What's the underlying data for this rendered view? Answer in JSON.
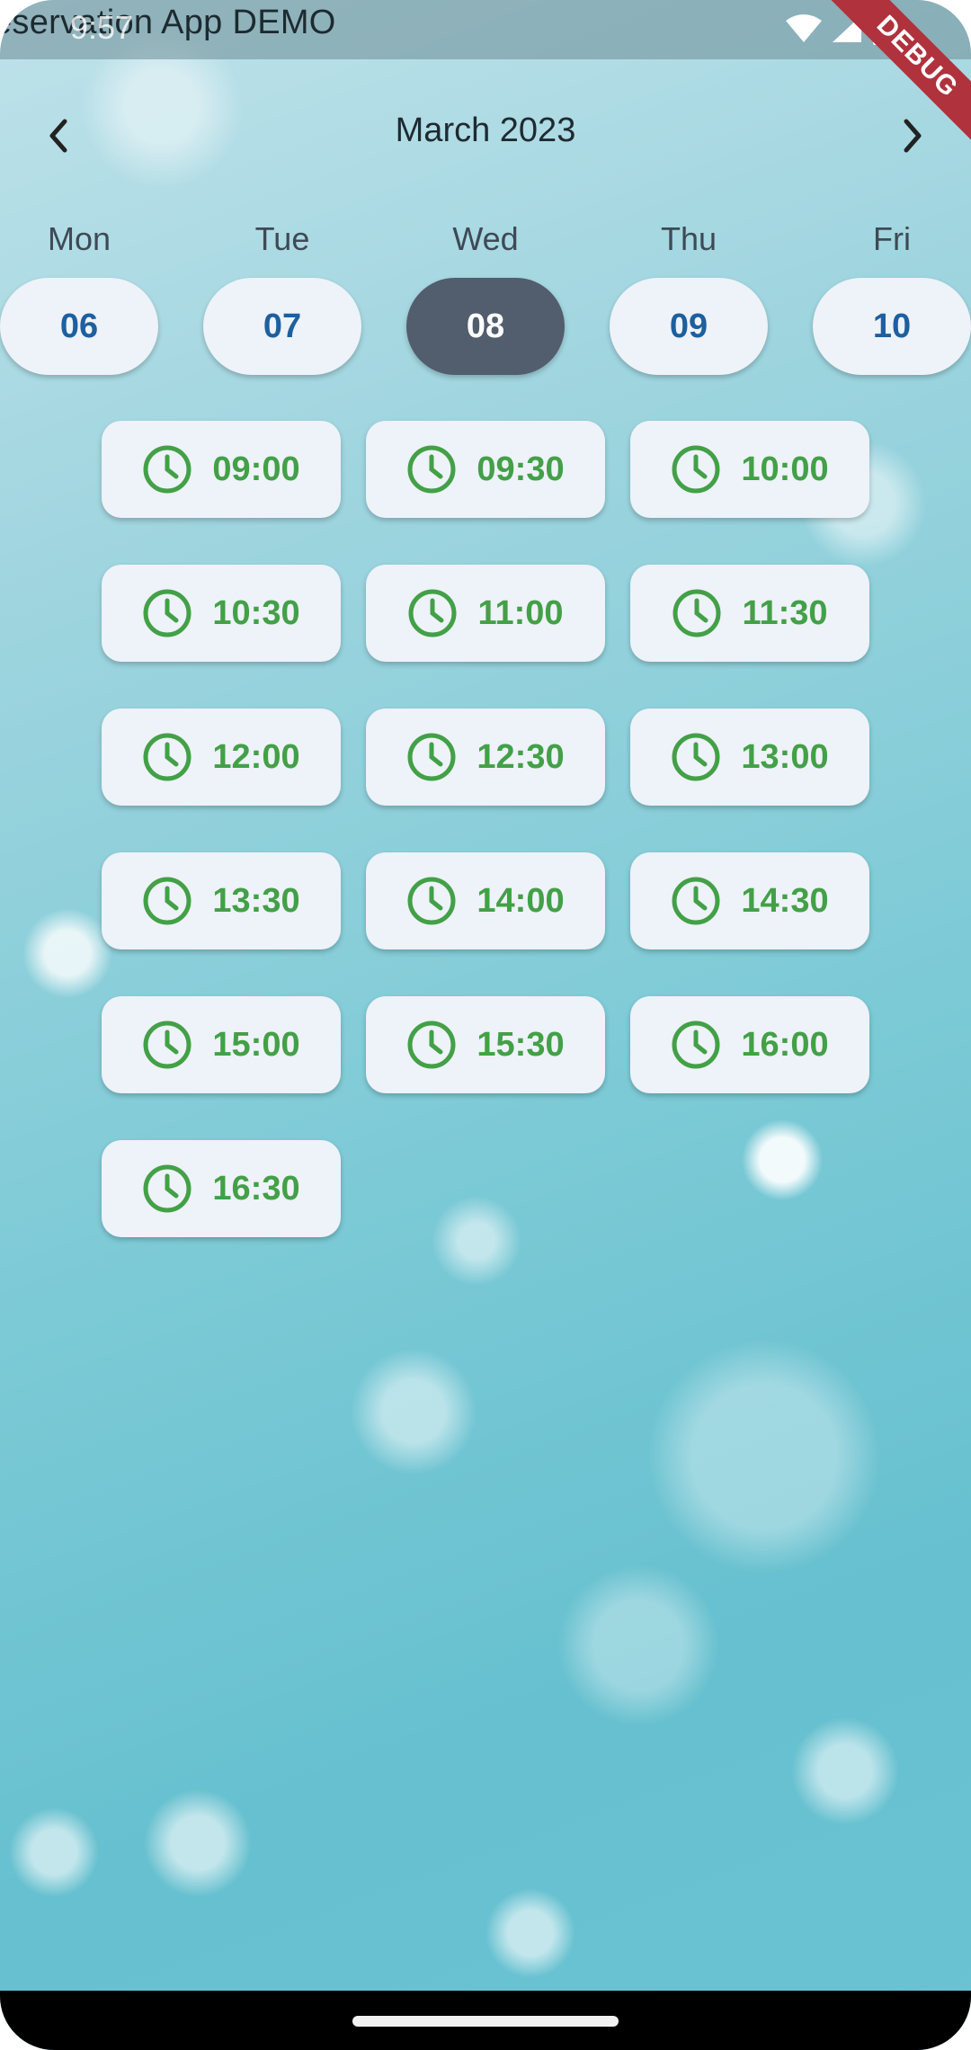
{
  "status_bar": {
    "app_title": "eservation App DEMO",
    "time": "9:57",
    "debug_label": "DEBUG"
  },
  "header": {
    "month_title": "March 2023",
    "prev_icon": "chevron-left-icon",
    "next_icon": "chevron-right-icon"
  },
  "days": [
    {
      "name": "Mon",
      "date": "06",
      "selected": false
    },
    {
      "name": "Tue",
      "date": "07",
      "selected": false
    },
    {
      "name": "Wed",
      "date": "08",
      "selected": true
    },
    {
      "name": "Thu",
      "date": "09",
      "selected": false
    },
    {
      "name": "Fri",
      "date": "10",
      "selected": false
    }
  ],
  "time_slots": [
    "09:00",
    "09:30",
    "10:00",
    "10:30",
    "11:00",
    "11:30",
    "12:00",
    "12:30",
    "13:00",
    "13:30",
    "14:00",
    "14:30",
    "15:00",
    "15:30",
    "16:00",
    "16:30"
  ],
  "colors": {
    "slot_text": "#43a047",
    "day_text": "#1e5f9e",
    "selected_day_bg": "#525d6d",
    "pill_bg": "#eef2f9"
  }
}
